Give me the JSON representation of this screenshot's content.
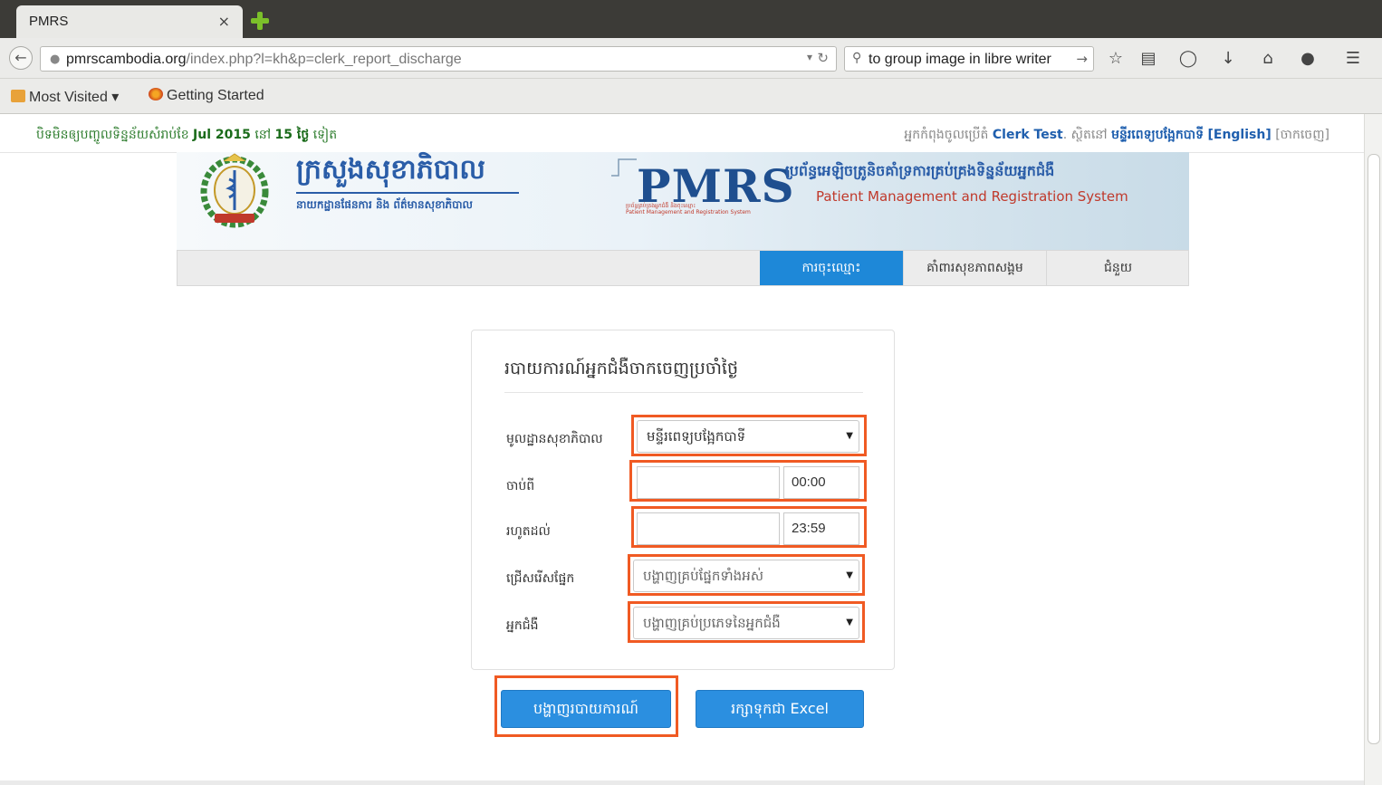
{
  "browser": {
    "tab_title": "PMRS",
    "tab_close": "×",
    "url_host": "pmrscambodia.org",
    "url_path": "/index.php?l=kh&p=clerk_report_discharge",
    "search_text": "to group image in libre writer",
    "bookmarks": [
      {
        "label": "Most Visited ▾",
        "icon": "folder-icon"
      },
      {
        "label": "Getting Started",
        "icon": "firefox-icon"
      }
    ],
    "toolbar_icons": [
      "star-icon",
      "reading-list-icon",
      "pocket-icon",
      "download-icon",
      "home-icon",
      "chat-icon",
      "menu-icon"
    ]
  },
  "info_bar": {
    "left_prefix": "បិទមិនឲ្យបញ្ចូលទិន្នន័យសំរាប់ខែ",
    "left_month": "Jul 2015",
    "left_mid": "នៅ",
    "left_days": "15 ថ្ងៃ",
    "left_suffix": "ទៀត",
    "right_prefix": "អ្នកកំពុងចូលប្រើតំ",
    "user": "Clerk Test",
    "right_mid": ". ស្ថិតនៅ",
    "site": "មន្ទីរពេទ្យបង្អែកបាទី",
    "lang_link": "[English]",
    "logout_link": "[ចាកចេញ]"
  },
  "banner": {
    "ministry_title": "ក្រសួងសុខាភិបាល",
    "ministry_sub": "នាយកដ្ឋានផែនការ និង ព័ត៌មានសុខាភិបាល",
    "pmrs": "PMRS",
    "pmrs_small_kh": "ប្រព័ន្ធគ្រប់គ្រងអ្នកជំងឺ និងចុះឈ្មោះ",
    "pmrs_small_en": "Patient Management and Registration System",
    "system_kh": "ប្រព័ន្ធអេឡិចត្រូនិចគាំទ្រការគ្រប់គ្រងទិន្នន័យអ្នកជំងឺ",
    "system_en": "Patient Management and Registration System"
  },
  "nav": {
    "tabs": [
      {
        "label": "ការចុះឈ្មោះ",
        "active": true
      },
      {
        "label": "គាំពារសុខភាពសង្គម",
        "active": false
      },
      {
        "label": "ជំនួយ",
        "active": false
      }
    ]
  },
  "form": {
    "title": "របាយការណ៍អ្នកជំងឺចាកចេញប្រចាំថ្ងៃ",
    "facility_label": "មូលដ្ឋានសុខាភិបាល",
    "facility_value": "មន្ទីរពេទ្យបង្អែកបាទី",
    "from_label": "ចាប់ពី",
    "from_date": "",
    "from_time": "00:00",
    "to_label": "រហូតដល់",
    "to_date": "",
    "to_time": "23:59",
    "department_label": "ជ្រើសរើសផ្នែក",
    "department_value": "បង្ហាញគ្រប់ផ្នែកទាំងអស់",
    "patient_label": "អ្នកជំងឺ",
    "patient_value": "បង្ហាញគ្រប់ប្រភេទនៃអ្នកជំងឺ",
    "show_button": "បង្ហាញរបាយការណ៍",
    "excel_button": "រក្សាទុកជា Excel"
  },
  "colors": {
    "highlight": "#f05a23",
    "primary": "#2b8fe0",
    "nav_active": "#1e88d8"
  }
}
